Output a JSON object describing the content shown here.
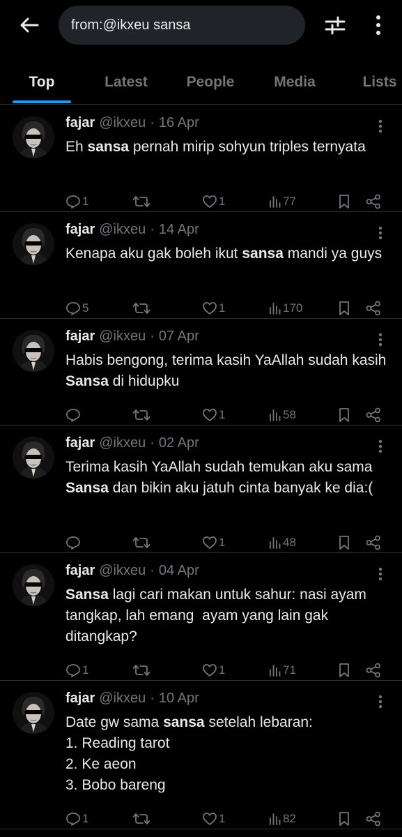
{
  "search": {
    "query": "from:@ikxeu sansa"
  },
  "tabs": [
    {
      "label": "Top",
      "active": true
    },
    {
      "label": "Latest",
      "active": false
    },
    {
      "label": "People",
      "active": false
    },
    {
      "label": "Media",
      "active": false
    },
    {
      "label": "Lists",
      "active": false
    }
  ],
  "colors": {
    "accent": "#1d9bf0",
    "background": "#000000",
    "muted": "#71767b",
    "text": "#e7e9ea"
  },
  "tweets": [
    {
      "name": "fajar",
      "handle": "@ikxeu",
      "separator": "·",
      "date": "16 Apr",
      "text_parts": [
        {
          "t": "Eh "
        },
        {
          "t": "sansa",
          "bold": true
        },
        {
          "t": " pernah mirip sohyun triples ternyata"
        }
      ],
      "replies": "1",
      "reposts": "",
      "likes": "1",
      "views": "77"
    },
    {
      "name": "fajar",
      "handle": "@ikxeu",
      "separator": "·",
      "date": "14 Apr",
      "text_parts": [
        {
          "t": "Kenapa aku gak boleh ikut "
        },
        {
          "t": "sansa",
          "bold": true
        },
        {
          "t": " mandi ya guys"
        }
      ],
      "replies": "5",
      "reposts": "",
      "likes": "1",
      "views": "170"
    },
    {
      "name": "fajar",
      "handle": "@ikxeu",
      "separator": "·",
      "date": "07 Apr",
      "text_parts": [
        {
          "t": "Habis bengong, terima kasih YaAllah sudah kasih "
        },
        {
          "t": "Sansa",
          "bold": true
        },
        {
          "t": " di hidupku"
        }
      ],
      "replies": "",
      "reposts": "",
      "likes": "1",
      "views": "58"
    },
    {
      "name": "fajar",
      "handle": "@ikxeu",
      "separator": "·",
      "date": "02 Apr",
      "text_parts": [
        {
          "t": "Terima kasih YaAllah sudah temukan aku sama "
        },
        {
          "t": "Sansa",
          "bold": true
        },
        {
          "t": " dan bikin aku jatuh cinta banyak ke dia:("
        }
      ],
      "replies": "",
      "reposts": "",
      "likes": "1",
      "views": "48"
    },
    {
      "name": "fajar",
      "handle": "@ikxeu",
      "separator": "·",
      "date": "04 Apr",
      "text_parts": [
        {
          "t": "Sansa",
          "bold": true
        },
        {
          "t": " lagi cari makan untuk sahur: nasi ayam tangkap, lah emang  ayam yang lain gak ditangkap?"
        }
      ],
      "replies": "1",
      "reposts": "",
      "likes": "1",
      "views": "71"
    },
    {
      "name": "fajar",
      "handle": "@ikxeu",
      "separator": "·",
      "date": "10 Apr",
      "text_parts": [
        {
          "t": "Date gw sama "
        },
        {
          "t": "sansa",
          "bold": true
        },
        {
          "t": " setelah lebaran:\n1. Reading tarot\n2. Ke aeon\n3. Bobo bareng"
        }
      ],
      "replies": "1",
      "reposts": "",
      "likes": "1",
      "views": "82"
    }
  ]
}
